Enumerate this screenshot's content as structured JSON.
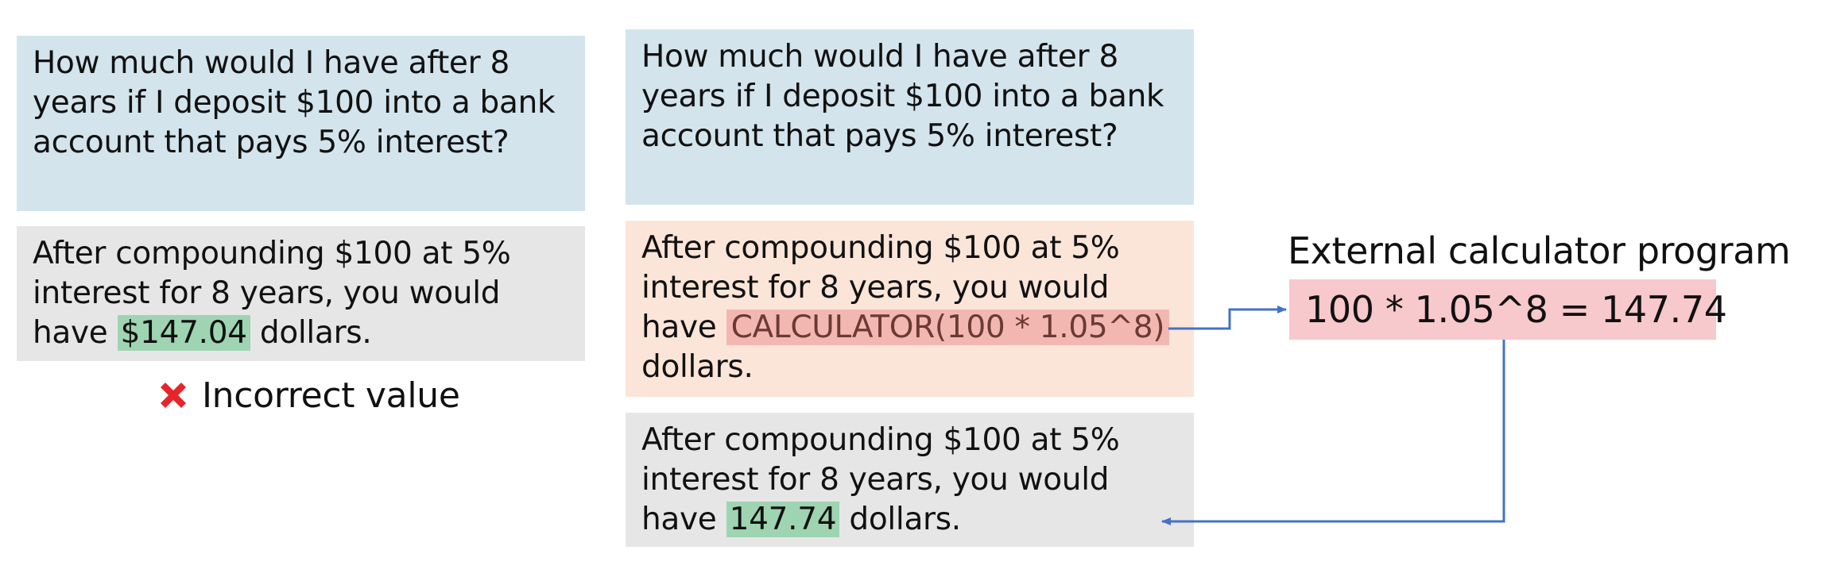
{
  "left": {
    "question": "How much would I have after 8 years if I deposit $100 into a bank account that pays 5% interest?",
    "answer_before": "After compounding  $100 at 5% interest for 8 years, you would have ",
    "answer_value": "$147.04",
    "answer_after": " dollars.",
    "verdict_icon": "cross-mark-icon",
    "verdict_label": "Incorrect value"
  },
  "right": {
    "question": "How much would I have after 8 years if I deposit $100 into a bank account that pays 5% interest?",
    "tool_before": "After compounding  $100 at 5% interest for 8 years, you would have ",
    "tool_call": "CALCULATOR(100 * 1.05^8)",
    "tool_after": " dollars.",
    "answer_before": "After compounding  $100 at 5% interest for 8 years, you would have ",
    "answer_value": "147.74",
    "answer_after": " dollars."
  },
  "calculator": {
    "title": "External calculator program",
    "expression": "100 * 1.05^8 = 147.74"
  },
  "colors": {
    "question_bg": "#d3e4ec",
    "answer_bg": "#e6e6e6",
    "tool_bg": "#fbe5d8",
    "value_highlight": "#9fd4b2",
    "tool_call_highlight": "#f3b7b1",
    "calculator_bg": "#f7c8cc",
    "arrow": "#4472c4",
    "cross": "#e8242b"
  }
}
